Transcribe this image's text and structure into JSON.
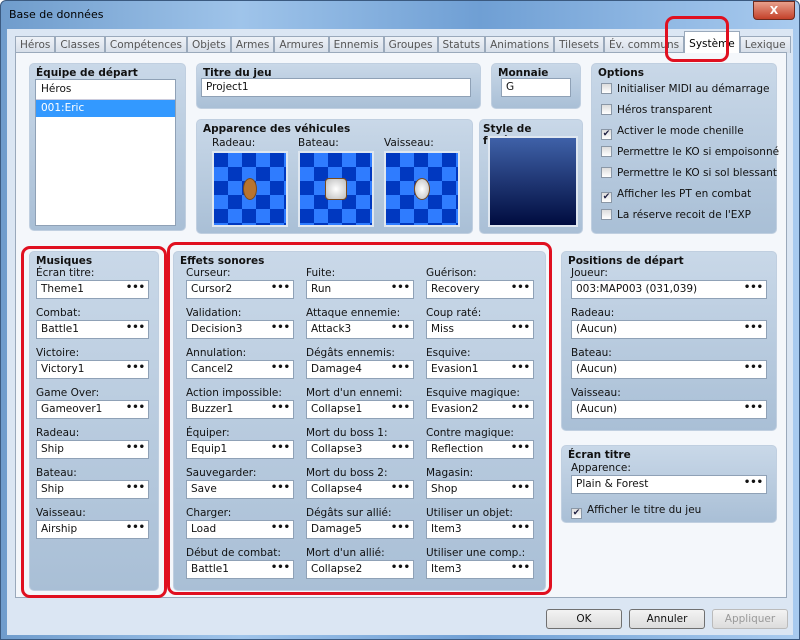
{
  "window": {
    "title": "Base de données",
    "close": "X"
  },
  "tabs": [
    "Héros",
    "Classes",
    "Compétences",
    "Objets",
    "Armes",
    "Armures",
    "Ennemis",
    "Groupes",
    "Statuts",
    "Animations",
    "Tilesets",
    "Év. communs",
    "Système",
    "Lexique"
  ],
  "active_tab": "Système",
  "party": {
    "title": "Équipe de départ",
    "header": "Héros",
    "items": [
      "001:Eric"
    ]
  },
  "game_title": {
    "title": "Titre du jeu",
    "value": "Project1"
  },
  "currency": {
    "title": "Monnaie",
    "value": "G"
  },
  "options": {
    "title": "Options",
    "items": [
      {
        "label": "Initialiser MIDI au démarrage",
        "checked": false
      },
      {
        "label": "Héros transparent",
        "checked": false
      },
      {
        "label": "Activer le mode chenille",
        "checked": true
      },
      {
        "label": "Permettre le KO si empoisonné",
        "checked": false
      },
      {
        "label": "Permettre le KO si sol blessant",
        "checked": false
      },
      {
        "label": "Afficher les PT en combat",
        "checked": true
      },
      {
        "label": "La réserve recoit de l'EXP",
        "checked": false
      }
    ]
  },
  "vehicles": {
    "title": "Apparence des véhicules",
    "items": [
      {
        "label": "Radeau:"
      },
      {
        "label": "Bateau:"
      },
      {
        "label": "Vaisseau:"
      }
    ]
  },
  "window_style": {
    "title": "Style de fenêtres"
  },
  "music": {
    "title": "Musiques",
    "items": [
      {
        "label": "Écran titre:",
        "value": "Theme1"
      },
      {
        "label": "Combat:",
        "value": "Battle1"
      },
      {
        "label": "Victoire:",
        "value": "Victory1"
      },
      {
        "label": "Game Over:",
        "value": "Gameover1"
      },
      {
        "label": "Radeau:",
        "value": "Ship"
      },
      {
        "label": "Bateau:",
        "value": "Ship"
      },
      {
        "label": "Vaisseau:",
        "value": "Airship"
      }
    ]
  },
  "sounds": {
    "title": "Effets sonores",
    "columns": [
      [
        {
          "label": "Curseur:",
          "value": "Cursor2"
        },
        {
          "label": "Validation:",
          "value": "Decision3"
        },
        {
          "label": "Annulation:",
          "value": "Cancel2"
        },
        {
          "label": "Action impossible:",
          "value": "Buzzer1"
        },
        {
          "label": "Équiper:",
          "value": "Equip1"
        },
        {
          "label": "Sauvegarder:",
          "value": "Save"
        },
        {
          "label": "Charger:",
          "value": "Load"
        },
        {
          "label": "Début de combat:",
          "value": "Battle1"
        }
      ],
      [
        {
          "label": "Fuite:",
          "value": "Run"
        },
        {
          "label": "Attaque ennemie:",
          "value": "Attack3"
        },
        {
          "label": "Dégâts ennemis:",
          "value": "Damage4"
        },
        {
          "label": "Mort d'un ennemi:",
          "value": "Collapse1"
        },
        {
          "label": "Mort du boss 1:",
          "value": "Collapse3"
        },
        {
          "label": "Mort du boss 2:",
          "value": "Collapse4"
        },
        {
          "label": "Dégâts sur allié:",
          "value": "Damage5"
        },
        {
          "label": "Mort d'un allié:",
          "value": "Collapse2"
        }
      ],
      [
        {
          "label": "Guérison:",
          "value": "Recovery"
        },
        {
          "label": "Coup raté:",
          "value": "Miss"
        },
        {
          "label": "Esquive:",
          "value": "Evasion1"
        },
        {
          "label": "Esquive magique:",
          "value": "Evasion2"
        },
        {
          "label": "Contre magique:",
          "value": "Reflection"
        },
        {
          "label": "Magasin:",
          "value": "Shop"
        },
        {
          "label": "Utiliser un objet:",
          "value": "Item3"
        },
        {
          "label": "Utiliser une comp.:",
          "value": "Item3"
        }
      ]
    ]
  },
  "start_positions": {
    "title": "Positions de départ",
    "items": [
      {
        "label": "Joueur:",
        "value": "003:MAP003 (031,039)"
      },
      {
        "label": "Radeau:",
        "value": "(Aucun)"
      },
      {
        "label": "Bateau:",
        "value": "(Aucun)"
      },
      {
        "label": "Vaisseau:",
        "value": "(Aucun)"
      }
    ]
  },
  "title_screen": {
    "title": "Écran titre",
    "appearance_label": "Apparence:",
    "appearance_value": "Plain & Forest",
    "show_title_label": "Afficher le titre du jeu",
    "show_title_checked": true
  },
  "buttons": {
    "ok": "OK",
    "cancel": "Annuler",
    "apply": "Appliquer"
  },
  "dots": "•••",
  "colors": {
    "highlight": "#e01020",
    "selection": "#3399ff"
  }
}
